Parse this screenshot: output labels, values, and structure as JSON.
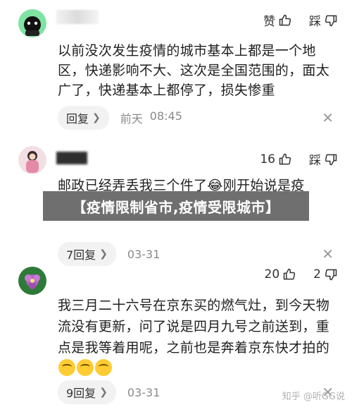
{
  "banner": {
    "text": "【疫情限制省市,疫情受限城市】"
  },
  "comments": [
    {
      "like_label": "赞",
      "dislike_label": "踩",
      "text": "以前没次发生疫情的城市基本上都是一个地区，快递影响不大、这次是全国范围的，面太广了，快递基本上都停了，损失惨重",
      "reply_label": "回复",
      "date": "前天",
      "time": "08:45"
    },
    {
      "like_count": "16",
      "dislike_label": "踩",
      "text": "邮政已经弄丢我三个件了😂刚开始说是疫",
      "reply_label": "7回复",
      "date": "03-31"
    },
    {
      "like_count": "20",
      "dislike_count": "2",
      "text": "我三月二十六号在京东买的燃气灶，到今天物流没有更新，问了说是四月九号之前送到，重点是我等着用呢，之前也是奔着京东快才拍的",
      "reply_label": "9回复",
      "date": "03-31"
    }
  ],
  "watermark": "知乎 @听GG说",
  "icons": {
    "like": "thumbs-up-icon",
    "dislike": "thumbs-down-icon",
    "close": "close-icon",
    "chevron": "chevron-right-icon"
  }
}
